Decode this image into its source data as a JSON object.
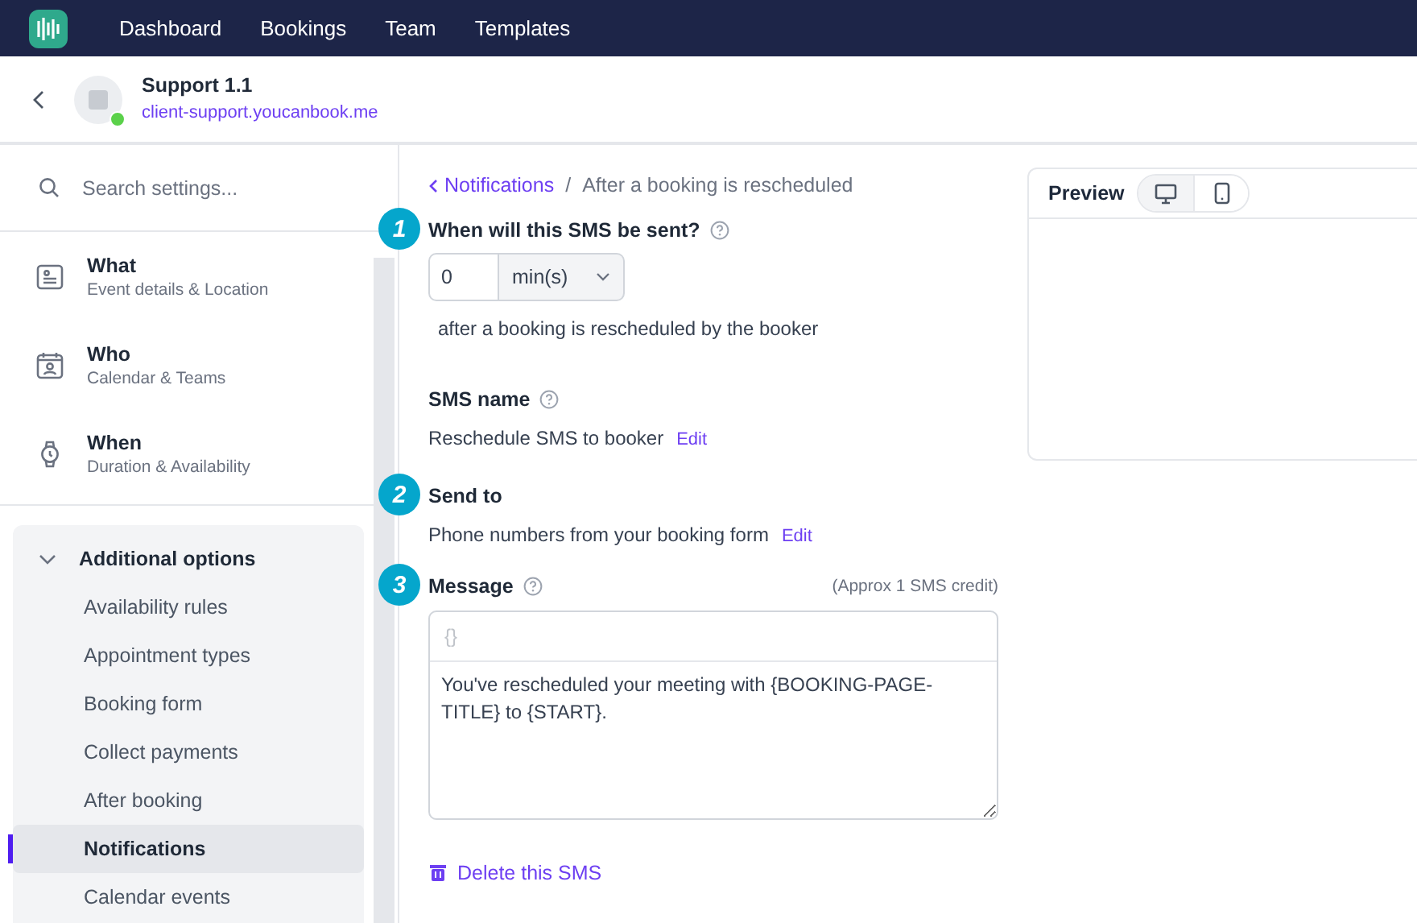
{
  "nav": {
    "items": [
      "Dashboard",
      "Bookings",
      "Team",
      "Templates"
    ]
  },
  "header": {
    "title": "Support 1.1",
    "url": "client-support.youcanbook.me",
    "online": true
  },
  "sidebar": {
    "search": {
      "placeholder": "Search settings..."
    },
    "sections": [
      {
        "kind": "what",
        "title": "What",
        "subtitle": "Event details & Location"
      },
      {
        "kind": "who",
        "title": "Who",
        "subtitle": "Calendar & Teams"
      },
      {
        "kind": "when",
        "title": "When",
        "subtitle": "Duration & Availability"
      }
    ],
    "additional": {
      "title": "Additional options",
      "expanded": true,
      "items": [
        {
          "label": "Availability rules",
          "selected": false
        },
        {
          "label": "Appointment types",
          "selected": false
        },
        {
          "label": "Booking form",
          "selected": false
        },
        {
          "label": "Collect payments",
          "selected": false
        },
        {
          "label": "After booking",
          "selected": false
        },
        {
          "label": "Notifications",
          "selected": true
        },
        {
          "label": "Calendar events",
          "selected": false
        }
      ]
    }
  },
  "breadcrumb": {
    "link": "Notifications",
    "separator": "/",
    "current": "After a booking is rescheduled"
  },
  "timing": {
    "step": "1",
    "label": "When will this SMS be sent?",
    "value": "0",
    "unit": "min(s)",
    "note": "after a booking is rescheduled by the booker"
  },
  "sms_name": {
    "label": "SMS name",
    "value": "Reschedule SMS to booker",
    "action": "Edit"
  },
  "send_to": {
    "step": "2",
    "label": "Send to",
    "value": "Phone numbers from your booking form",
    "action": "Edit"
  },
  "message": {
    "step": "3",
    "label": "Message",
    "credit": "(Approx 1 SMS credit)",
    "token_button": "{}",
    "text": "You've rescheduled your meeting with {BOOKING-PAGE-TITLE} to {START}."
  },
  "delete": {
    "label": "Delete this SMS"
  },
  "preview": {
    "title": "Preview",
    "modes": [
      {
        "kind": "desktop",
        "selected": true
      },
      {
        "kind": "mobile",
        "selected": false
      }
    ]
  }
}
